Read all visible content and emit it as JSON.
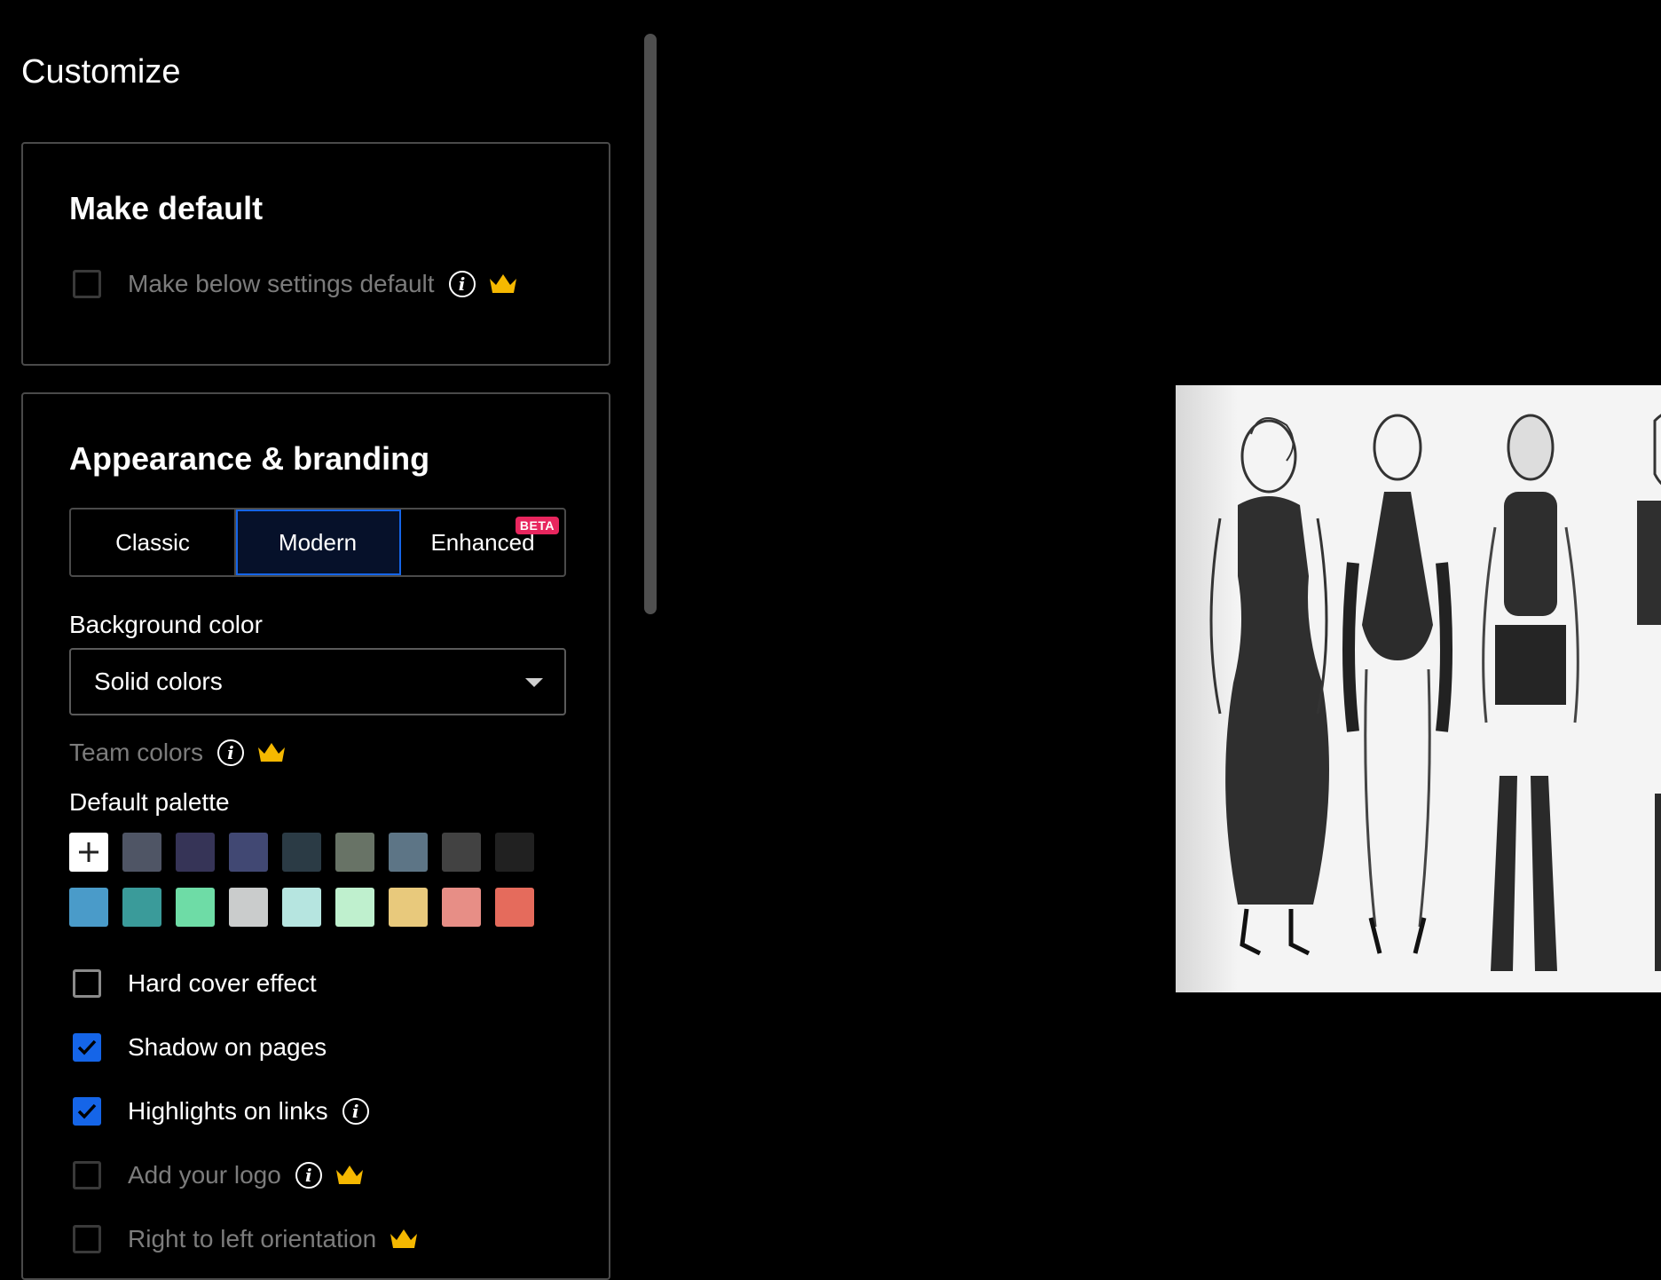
{
  "customize": {
    "title": "Customize"
  },
  "make_default": {
    "title": "Make default",
    "option_label": "Make below settings default",
    "checked": false,
    "disabled": true
  },
  "appearance": {
    "title": "Appearance & branding",
    "modes": [
      {
        "label": "Classic",
        "active": false
      },
      {
        "label": "Modern",
        "active": true
      },
      {
        "label": "Enhanced",
        "active": false,
        "badge": "BETA"
      }
    ],
    "background_label": "Background color",
    "background_value": "Solid colors",
    "team_colors_label": "Team colors",
    "palette_label": "Default palette",
    "palette_row1": [
      "#4f5565",
      "#363457",
      "#414873",
      "#2b3b45",
      "#687366",
      "#5d7586",
      "#424242",
      "#212121"
    ],
    "palette_row2": [
      "#4a9bc9",
      "#3a9b9a",
      "#6edca6",
      "#cacccc",
      "#b6e5e0",
      "#bff0ce",
      "#e8c97c",
      "#e78e86",
      "#e56b5c"
    ],
    "options": [
      {
        "label": "Hard cover effect",
        "checked": false,
        "disabled": false,
        "info": false,
        "premium": false
      },
      {
        "label": "Shadow on pages",
        "checked": true,
        "disabled": false,
        "info": false,
        "premium": false
      },
      {
        "label": "Highlights on links",
        "checked": true,
        "disabled": false,
        "info": true,
        "premium": false
      },
      {
        "label": "Add your logo",
        "checked": false,
        "disabled": true,
        "info": true,
        "premium": true
      },
      {
        "label": "Right to left orientation",
        "checked": false,
        "disabled": true,
        "info": false,
        "premium": true
      }
    ]
  },
  "colors": {
    "accent": "#1565e8",
    "premium": "#f5b800",
    "badge": "#e8265e",
    "border": "#4a4a4a"
  },
  "icons": [
    "info-icon",
    "crown-icon",
    "check-icon",
    "plus-icon",
    "chevron-down-icon"
  ]
}
